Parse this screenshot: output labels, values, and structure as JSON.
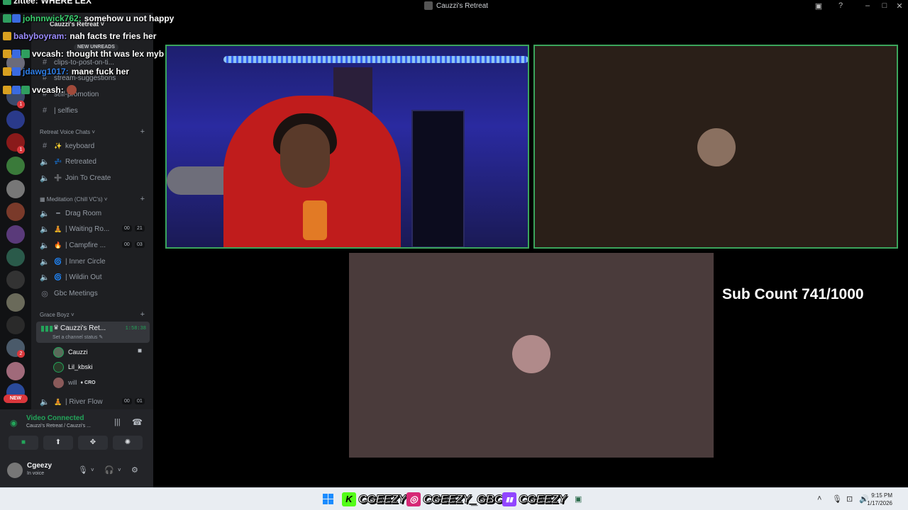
{
  "window": {
    "title": "Cauzzi's Retreat"
  },
  "server": {
    "name": "Cauzzi's Retreat",
    "new_unreads": "NEW UNREADS"
  },
  "channels_top": [
    {
      "name": "clips-to-post-on-ti...",
      "icon": "hash-icon"
    },
    {
      "name": "stream-suggestions",
      "icon": "hash-icon"
    },
    {
      "name": "self-promotion",
      "icon": "hash-icon"
    },
    {
      "name": "| selfies",
      "icon": "hash-icon"
    }
  ],
  "categories": {
    "retreat_voice": "Retreat Voice Chats",
    "meditation": "Meditation (Chill VC's)",
    "grace": "Grace Boyz"
  },
  "retreat_voice_channels": [
    {
      "name": "keyboard",
      "emoji": "✨"
    },
    {
      "name": "Retreated",
      "emoji": "💤"
    },
    {
      "name": "Join To Create",
      "emoji": "➕"
    }
  ],
  "meditation_channels": [
    {
      "name": "Drag Room",
      "emoji": "━",
      "counts": null
    },
    {
      "name": "| Waiting Ro...",
      "emoji": "🧘",
      "counts": [
        "00",
        "21"
      ]
    },
    {
      "name": "| Campfire ...",
      "emoji": "🔥",
      "counts": [
        "00",
        "03"
      ]
    },
    {
      "name": "| Inner Circle",
      "emoji": "🌀",
      "counts": null
    },
    {
      "name": "| Wildin Out",
      "emoji": "🌀",
      "counts": null
    },
    {
      "name": "Gbc Meetings",
      "emoji": "",
      "counts": null
    }
  ],
  "active_channel": {
    "name": "Cauzzi's Ret...",
    "timer": "1:58:38",
    "status": "Set a channel status"
  },
  "voice_members": [
    {
      "name": "Cauzzi",
      "badge": ""
    },
    {
      "name": "Lil_kbski",
      "badge": ""
    },
    {
      "name": "will",
      "badge": "CRO"
    }
  ],
  "river_flow": {
    "name": "| River Flow",
    "counts": [
      "00",
      "01"
    ]
  },
  "voice_panel": {
    "status": "Video Connected",
    "subtitle": "Cauzzi's Retreat / Cauzzi's ..."
  },
  "user": {
    "name": "Cgeezy",
    "status": "In voice"
  },
  "rail": {
    "new_label": "NEW"
  },
  "chat": [
    {
      "user": "zittee:",
      "text": "WHERE LEX",
      "color": "#ffffff"
    },
    {
      "user": "johnnwick762:",
      "text": "somehow u not happy",
      "color": "#3bd16f"
    },
    {
      "user": "babyboyram:",
      "text": "nah facts tre fries her",
      "color": "#9b8cff"
    },
    {
      "user": "vvcash:",
      "text": "thought tht was lex myb",
      "color": "#ffffff"
    },
    {
      "user": "jdawg1017:",
      "text": "mane fuck her",
      "color": "#2f7fe8"
    },
    {
      "user": "vvcash:",
      "text": "",
      "color": "#ffffff"
    }
  ],
  "overlay": {
    "subcount": "Sub Count 741/1000"
  },
  "socials": [
    {
      "icon": "kick-icon",
      "glyph": "K",
      "color": "#53fc18",
      "handle": "CGEEZY"
    },
    {
      "icon": "instagram-icon",
      "glyph": "◎",
      "color": "#d62976",
      "handle": "CGEEZY_GBC"
    },
    {
      "icon": "twitch-icon",
      "glyph": "▮▮",
      "color": "#9146ff",
      "handle": "CGEEZY"
    }
  ],
  "clock": {
    "time": "9:15 PM",
    "date": "1/17/2026"
  },
  "colors": {
    "accent_green": "#23a55a",
    "tile_border": "#3ba55c",
    "danger": "#da373c"
  }
}
